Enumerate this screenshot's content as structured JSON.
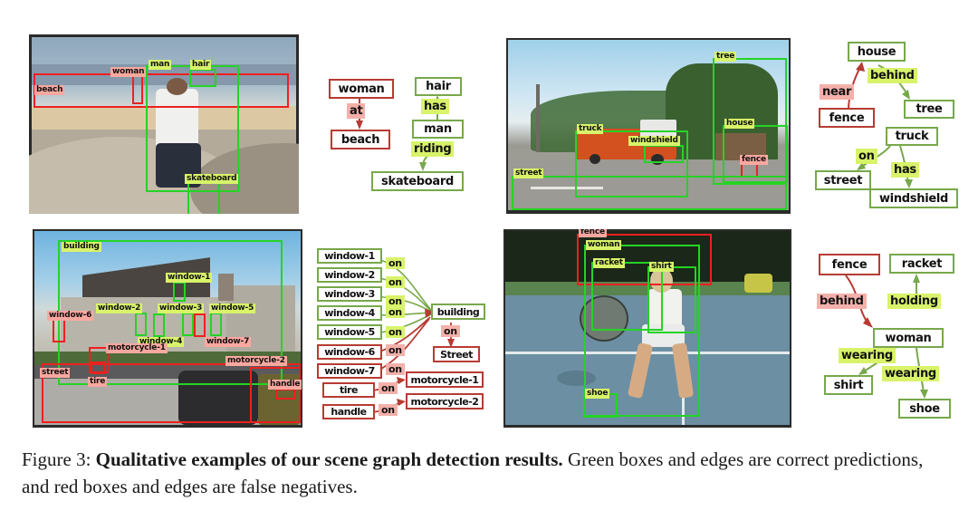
{
  "figure": {
    "caption_label": "Figure 3:",
    "caption_bold": "Qualitative examples of our scene graph detection results.",
    "caption_rest": " Green boxes and edges are correct predictions, and red boxes and edges are false negatives."
  },
  "colors": {
    "correct_box": "#25d325",
    "false_negative_box": "#ee2020",
    "correct_node_border": "#77a84b",
    "false_negative_node_border": "#b73b33",
    "correct_edge_highlight": "#d8f36a",
    "false_negative_edge_highlight": "#f4b0aa"
  },
  "examples": [
    {
      "id": "skateboard",
      "image_labels": [
        {
          "text": "woman",
          "kind": "false-negative"
        },
        {
          "text": "beach",
          "kind": "false-negative"
        },
        {
          "text": "man",
          "kind": "correct"
        },
        {
          "text": "hair",
          "kind": "correct"
        },
        {
          "text": "skateboard",
          "kind": "correct"
        }
      ],
      "graph": {
        "nodes": [
          {
            "text": "woman",
            "kind": "false-negative"
          },
          {
            "text": "beach",
            "kind": "false-negative"
          },
          {
            "text": "hair",
            "kind": "correct"
          },
          {
            "text": "man",
            "kind": "correct"
          },
          {
            "text": "skateboard",
            "kind": "correct"
          }
        ],
        "edges": [
          {
            "text": "at",
            "kind": "false-negative",
            "from": "woman",
            "to": "beach"
          },
          {
            "text": "has",
            "kind": "correct",
            "from": "man",
            "to": "hair"
          },
          {
            "text": "riding",
            "kind": "correct",
            "from": "man",
            "to": "skateboard"
          }
        ]
      }
    },
    {
      "id": "truck",
      "image_labels": [
        {
          "text": "tree",
          "kind": "correct"
        },
        {
          "text": "house",
          "kind": "correct"
        },
        {
          "text": "truck",
          "kind": "correct"
        },
        {
          "text": "windshield",
          "kind": "correct"
        },
        {
          "text": "street",
          "kind": "correct"
        },
        {
          "text": "fence",
          "kind": "false-negative"
        }
      ],
      "graph": {
        "nodes": [
          {
            "text": "house",
            "kind": "correct"
          },
          {
            "text": "tree",
            "kind": "correct"
          },
          {
            "text": "fence",
            "kind": "false-negative"
          },
          {
            "text": "truck",
            "kind": "correct"
          },
          {
            "text": "street",
            "kind": "correct"
          },
          {
            "text": "windshield",
            "kind": "correct"
          }
        ],
        "edges": [
          {
            "text": "near",
            "kind": "false-negative",
            "from": "fence",
            "to": "house"
          },
          {
            "text": "behind",
            "kind": "correct",
            "from": "house",
            "to": "tree"
          },
          {
            "text": "on",
            "kind": "correct",
            "from": "truck",
            "to": "street"
          },
          {
            "text": "has",
            "kind": "correct",
            "from": "truck",
            "to": "windshield"
          }
        ]
      }
    },
    {
      "id": "building",
      "image_labels": [
        {
          "text": "building",
          "kind": "correct"
        },
        {
          "text": "window-1",
          "kind": "correct"
        },
        {
          "text": "window-2",
          "kind": "correct"
        },
        {
          "text": "window-3",
          "kind": "correct"
        },
        {
          "text": "window-4",
          "kind": "correct"
        },
        {
          "text": "window-5",
          "kind": "correct"
        },
        {
          "text": "window-6",
          "kind": "false-negative"
        },
        {
          "text": "window-7",
          "kind": "false-negative"
        },
        {
          "text": "motorcycle-1",
          "kind": "false-negative"
        },
        {
          "text": "motorcycle-2",
          "kind": "false-negative"
        },
        {
          "text": "street",
          "kind": "false-negative"
        },
        {
          "text": "tire",
          "kind": "false-negative"
        },
        {
          "text": "handle",
          "kind": "false-negative"
        }
      ],
      "graph": {
        "nodes": [
          {
            "text": "window-1",
            "kind": "correct"
          },
          {
            "text": "window-2",
            "kind": "correct"
          },
          {
            "text": "window-3",
            "kind": "correct"
          },
          {
            "text": "window-4",
            "kind": "correct"
          },
          {
            "text": "window-5",
            "kind": "correct"
          },
          {
            "text": "window-6",
            "kind": "false-negative"
          },
          {
            "text": "window-7",
            "kind": "false-negative"
          },
          {
            "text": "tire",
            "kind": "false-negative"
          },
          {
            "text": "handle",
            "kind": "false-negative"
          },
          {
            "text": "building",
            "kind": "correct"
          },
          {
            "text": "Street",
            "kind": "false-negative"
          },
          {
            "text": "motorcycle-1",
            "kind": "false-negative"
          },
          {
            "text": "motorcycle-2",
            "kind": "false-negative"
          }
        ],
        "edges": [
          {
            "text": "on",
            "kind": "correct",
            "from": "window-1",
            "to": "building"
          },
          {
            "text": "on",
            "kind": "correct",
            "from": "window-2",
            "to": "building"
          },
          {
            "text": "on",
            "kind": "correct",
            "from": "window-3",
            "to": "building"
          },
          {
            "text": "on",
            "kind": "correct",
            "from": "window-4",
            "to": "building"
          },
          {
            "text": "on",
            "kind": "correct",
            "from": "window-5",
            "to": "building"
          },
          {
            "text": "on",
            "kind": "false-negative",
            "from": "window-6",
            "to": "building"
          },
          {
            "text": "on",
            "kind": "false-negative",
            "from": "window-7",
            "to": "building"
          },
          {
            "text": "on",
            "kind": "false-negative",
            "from": "building",
            "to": "Street"
          },
          {
            "text": "on",
            "kind": "false-negative",
            "from": "tire",
            "to": "motorcycle-1"
          },
          {
            "text": "on",
            "kind": "false-negative",
            "from": "handle",
            "to": "motorcycle-2"
          }
        ]
      }
    },
    {
      "id": "tennis",
      "image_labels": [
        {
          "text": "fence",
          "kind": "false-negative"
        },
        {
          "text": "woman",
          "kind": "correct"
        },
        {
          "text": "racket",
          "kind": "correct"
        },
        {
          "text": "shirt",
          "kind": "correct"
        },
        {
          "text": "shoe",
          "kind": "correct"
        }
      ],
      "graph": {
        "nodes": [
          {
            "text": "fence",
            "kind": "false-negative"
          },
          {
            "text": "racket",
            "kind": "correct"
          },
          {
            "text": "woman",
            "kind": "correct"
          },
          {
            "text": "shirt",
            "kind": "correct"
          },
          {
            "text": "shoe",
            "kind": "correct"
          }
        ],
        "edges": [
          {
            "text": "behind",
            "kind": "false-negative",
            "from": "fence",
            "to": "woman"
          },
          {
            "text": "holding",
            "kind": "correct",
            "from": "woman",
            "to": "racket"
          },
          {
            "text": "wearing",
            "kind": "correct",
            "from": "woman",
            "to": "shirt"
          },
          {
            "text": "wearing",
            "kind": "correct",
            "from": "woman",
            "to": "shoe"
          }
        ]
      }
    }
  ]
}
